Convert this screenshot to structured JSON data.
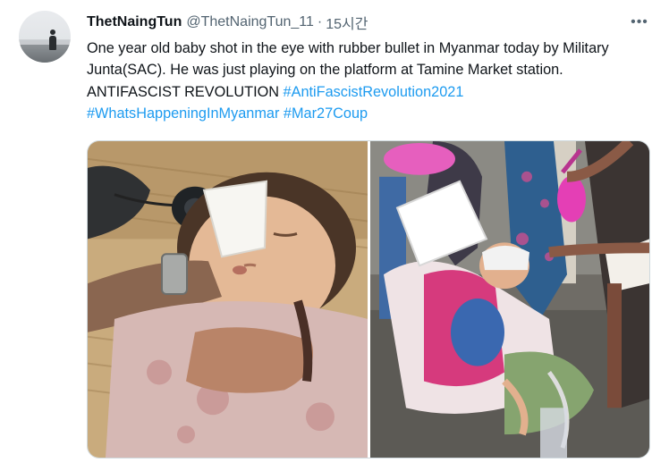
{
  "tweet": {
    "display_name": "ThetNaingTun",
    "handle": "@ThetNaingTun_11",
    "separator": "·",
    "time": "15시간",
    "more_icon": "more-horizontal-icon",
    "body_text": "One year old baby shot in the eye with rubber bullet in Myanmar today by Military Junta(SAC). He was just playing on the platform at Tamine Market station. ANTIFASCIST REVOLUTION",
    "hashtags": [
      "#AntiFascistRevolution2021",
      "#WhatsHappeningInMyanmar",
      "#Mar27Coup"
    ],
    "link_color": "#1d9bf0"
  },
  "media": {
    "photo_count": 2
  }
}
